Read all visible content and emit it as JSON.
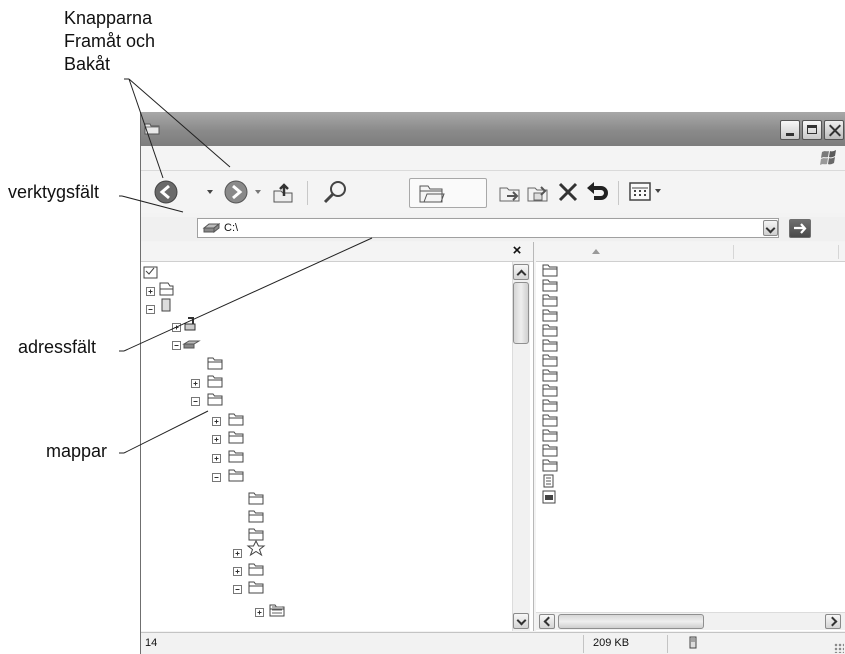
{
  "annotations": {
    "back_forward": "Knapparna Framåt och Bakåt",
    "toolbar": "verktygsfält",
    "address_bar": "adressfält",
    "folders": "mappar"
  },
  "addressbar": {
    "value": "C:\\"
  },
  "panes": {
    "close_glyph": "×"
  },
  "statusbar": {
    "object_count": "14",
    "size": "209 KB"
  },
  "icons": {
    "back": "back-arrow-icon",
    "forward": "forward-arrow-icon",
    "up": "up-folder-icon",
    "search": "search-icon",
    "folders": "folders-icon",
    "move_to": "move-to-icon",
    "copy_to": "copy-to-icon",
    "delete": "delete-icon",
    "undo": "undo-icon",
    "views": "views-icon"
  },
  "colors": {
    "titlebar": "#8a8a8a",
    "window": "#f3f3f3",
    "go_button": "#555555"
  }
}
